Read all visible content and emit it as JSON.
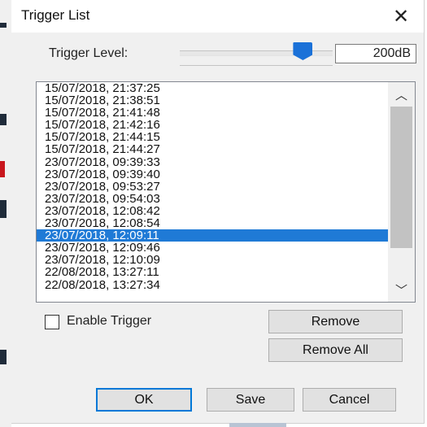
{
  "window": {
    "title": "Trigger List",
    "close_glyph": "✕"
  },
  "trigger_level": {
    "label": "Trigger Level:",
    "value": "200dB",
    "slider_fraction": 0.85
  },
  "trigger_list": {
    "items": [
      "15/07/2018, 21:37:25",
      "15/07/2018, 21:38:51",
      "15/07/2018, 21:41:48",
      "15/07/2018, 21:42:16",
      "15/07/2018, 21:44:15",
      "15/07/2018, 21:44:27",
      "23/07/2018, 09:39:33",
      "23/07/2018, 09:39:40",
      "23/07/2018, 09:53:27",
      "23/07/2018, 09:54:03",
      "23/07/2018, 12:08:42",
      "23/07/2018, 12:08:54",
      "23/07/2018, 12:09:11",
      "23/07/2018, 12:09:46",
      "23/07/2018, 12:10:09",
      "22/08/2018, 13:27:11",
      "22/08/2018, 13:27:34"
    ],
    "selected_index": 12,
    "scroll_up_glyph": "︿",
    "scroll_down_glyph": "﹀"
  },
  "enable_trigger": {
    "label": "Enable Trigger",
    "checked": false
  },
  "buttons": {
    "remove": "Remove",
    "remove_all": "Remove All",
    "ok": "OK",
    "save": "Save",
    "cancel": "Cancel"
  },
  "colors": {
    "accent": "#1a71d8",
    "selection": "#1f7ad6",
    "default_button_border": "#0078d7"
  }
}
